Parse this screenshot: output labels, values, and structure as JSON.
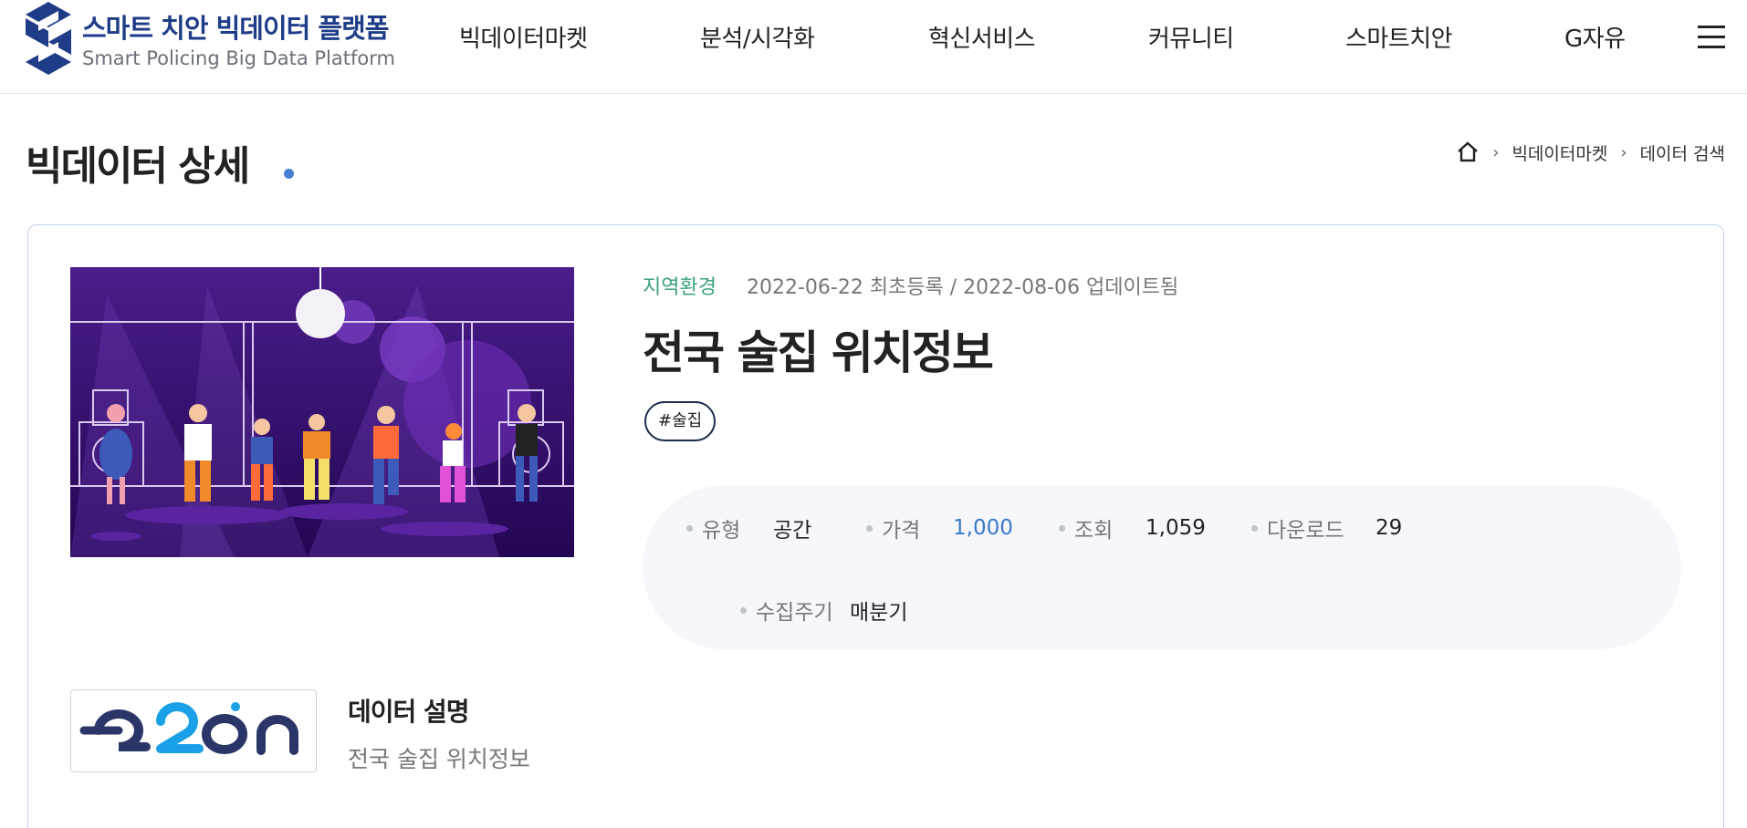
{
  "header": {
    "logo_kr": "스마트 치안 빅데이터 플랫폼",
    "logo_en": "Smart Policing Big Data Platform",
    "brand_color": "#1f3c88",
    "nav": [
      {
        "label": "빅데이터마켓"
      },
      {
        "label": "분석/시각화"
      },
      {
        "label": "혁신서비스"
      },
      {
        "label": "커뮤니티"
      },
      {
        "label": "스마트치안"
      },
      {
        "label": "G자유"
      }
    ],
    "menu_icon": "hamburger-icon"
  },
  "page": {
    "title": "빅데이터 상세",
    "breadcrumb": {
      "home_icon": "home-icon",
      "items": [
        "빅데이터마켓",
        "데이터 검색"
      ]
    }
  },
  "detail": {
    "category": "지역환경",
    "dates": "2022-06-22 최초등록 / 2022-08-06 업데이트됨",
    "title": "전국 술집 위치정보",
    "tag": "#술집",
    "info": {
      "type_label": "유형",
      "type_value": "공간",
      "price_label": "가격",
      "price_value": "1,000",
      "views_label": "조회",
      "views_value": "1,059",
      "downloads_label": "다운로드",
      "downloads_value": "29",
      "cycle_label": "수집주기",
      "cycle_value": "매분기"
    },
    "org_logo_text": "e2on",
    "description_heading": "데이터 설명",
    "description": "전국 술집 위치정보"
  },
  "colors": {
    "accent_blue": "#4a7fd6",
    "category_green": "#3aa27a",
    "price_blue": "#3b78c8",
    "card_border": "#c4d3ea",
    "info_bg": "#f5f7fb"
  }
}
